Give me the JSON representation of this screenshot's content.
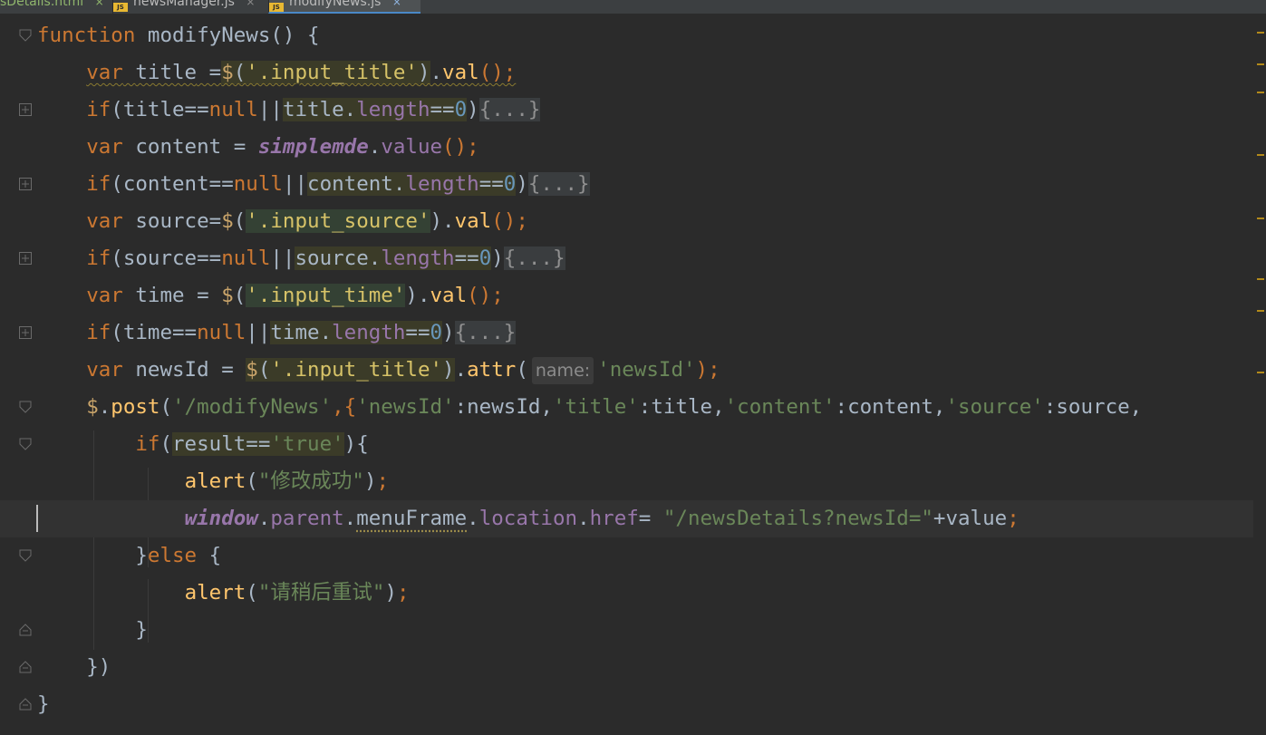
{
  "tabs": [
    {
      "label": "sDetails.html"
    },
    {
      "label": "newsManager.js"
    },
    {
      "label": "modifyNews.js",
      "active": true
    }
  ],
  "tab_close_glyph": "×",
  "tab_icon_text": "JS",
  "code": {
    "l1": {
      "kw": "function",
      "name": "modifyNews",
      "rest": "() {"
    },
    "l2": {
      "kw": "var",
      "v": "title",
      "eq": " =",
      "dollar": "$",
      "open": "(",
      "str": "'.input_title'",
      "close": ")",
      "dot": ".",
      "fn": "val",
      "end": "();"
    },
    "l3": {
      "kw": "if",
      "a": "(title==",
      "nul": "null",
      "or": "||",
      "b": "title",
      "dot": ".",
      "prop": "length",
      "eq": "==",
      "num": "0",
      "c": ")",
      "ph": "{...}"
    },
    "l4": {
      "kw": "var",
      "v": "content",
      "eq": " = ",
      "glob": "simplemde",
      "dot": ".",
      "prop": "value",
      "end": "();"
    },
    "l5": {
      "kw": "if",
      "a": "(content==",
      "nul": "null",
      "or": "||",
      "b": "content",
      "dot": ".",
      "prop": "length",
      "eq": "==",
      "num": "0",
      "c": ")",
      "ph": "{...}"
    },
    "l6": {
      "kw": "var",
      "v": "source",
      "eq": "=",
      "dollar": "$",
      "open": "(",
      "str": "'.input_source'",
      "close": ")",
      "dot": ".",
      "fn": "val",
      "end": "();"
    },
    "l7": {
      "kw": "if",
      "a": "(source==",
      "nul": "null",
      "or": "||",
      "b": "source",
      "dot": ".",
      "prop": "length",
      "eq": "==",
      "num": "0",
      "c": ")",
      "ph": "{...}"
    },
    "l8": {
      "kw": "var",
      "v": "time",
      "eq": " = ",
      "dollar": "$",
      "open": "(",
      "str": "'.input_time'",
      "close": ")",
      "dot": ".",
      "fn": "val",
      "end": "();"
    },
    "l9": {
      "kw": "if",
      "a": "(time==",
      "nul": "null",
      "or": "||",
      "b": "time",
      "dot": ".",
      "prop": "length",
      "eq": "==",
      "num": "0",
      "c": ")",
      "ph": "{...}"
    },
    "l10": {
      "kw": "var",
      "v": "newsId",
      "eq": " = ",
      "dollar": "$",
      "open": "(",
      "str": "'.input_title'",
      "close": ")",
      "dot": ".",
      "fn": "attr",
      "open2": "(",
      "hint": "name:",
      "str2": "'newsId'",
      "end": ");"
    },
    "l11": {
      "dollar": "$",
      "dot": ".",
      "fn": "post",
      "open": "(",
      "s1": "'/modifyNews'",
      "c1": ",{",
      "k1": "'newsId'",
      "v1": ":newsId,",
      "k2": "'title'",
      "v2": ":title,",
      "k3": "'content'",
      "v3": ":content,",
      "k4": "'source'",
      "v4": ":source,"
    },
    "l12": {
      "kw": "if",
      "open": "(",
      "a": "result==",
      "str": "'true'",
      "close": "){"
    },
    "l13": {
      "fn": "alert",
      "open": "(",
      "str": "\"修改成功\"",
      "close": ")",
      "end": ";"
    },
    "l14": {
      "glob": "window",
      "d1": ".",
      "p1": "parent",
      "d2": ".",
      "p2": "menuFrame",
      "d3": ".",
      "p3": "location",
      "d4": ".",
      "p4": "href",
      "eq": "= ",
      "str": "\"/newsDetails?newsId=\"",
      "plus": "+value",
      "end": ";"
    },
    "l15": {
      "close": "}",
      "kw": "else",
      "rest": " {"
    },
    "l16": {
      "fn": "alert",
      "open": "(",
      "str": "\"请稍后重试\"",
      "close": ")",
      "end": ";"
    },
    "l17": {
      "close": "}"
    },
    "l18": {
      "close": "})"
    },
    "l19": {
      "close": "}"
    }
  },
  "colors": {
    "background": "#2b2b2b",
    "keyword": "#cc7832",
    "string": "#6a8759",
    "number": "#6897bb",
    "property": "#9876aa",
    "function": "#ffc66d",
    "identifier": "#a9b7c6"
  }
}
